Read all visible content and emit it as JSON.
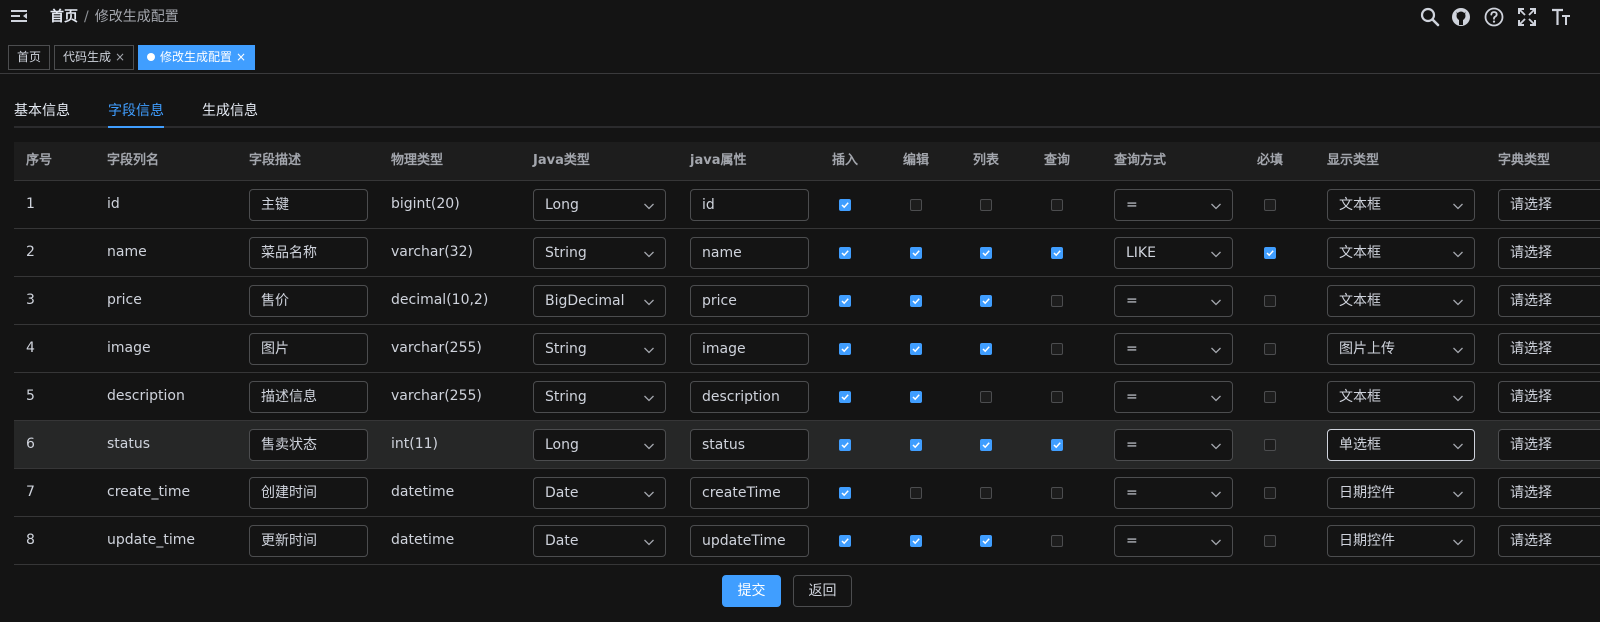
{
  "header": {
    "breadcrumb": {
      "home": "首页",
      "separator": "/",
      "current": "修改生成配置"
    },
    "icons": [
      "hamburger-icon",
      "search-icon",
      "github-icon",
      "help-icon",
      "fullscreen-icon",
      "font-size-icon"
    ]
  },
  "tags": [
    {
      "label": "首页",
      "closable": false,
      "active": false
    },
    {
      "label": "代码生成",
      "closable": true,
      "active": false
    },
    {
      "label": "修改生成配置",
      "closable": true,
      "active": true
    }
  ],
  "tag_close_glyph": "×",
  "tabs": [
    {
      "label": "基本信息",
      "active": false
    },
    {
      "label": "字段信息",
      "active": true
    },
    {
      "label": "生成信息",
      "active": false
    }
  ],
  "table": {
    "headers": [
      "序号",
      "字段列名",
      "字段描述",
      "物理类型",
      "Java类型",
      "java属性",
      "插入",
      "编辑",
      "列表",
      "查询",
      "查询方式",
      "必填",
      "显示类型",
      "字典类型"
    ],
    "rows": [
      {
        "no": "1",
        "column": "id",
        "desc": "主键",
        "physical": "bigint(20)",
        "java_type": "Long",
        "java_field": "id",
        "insert": true,
        "edit": false,
        "list": false,
        "query": false,
        "query_type": "=",
        "required": false,
        "html_type": "文本框",
        "dict": "请选择"
      },
      {
        "no": "2",
        "column": "name",
        "desc": "菜品名称",
        "physical": "varchar(32)",
        "java_type": "String",
        "java_field": "name",
        "insert": true,
        "edit": true,
        "list": true,
        "query": true,
        "query_type": "LIKE",
        "required": true,
        "html_type": "文本框",
        "dict": "请选择"
      },
      {
        "no": "3",
        "column": "price",
        "desc": "售价",
        "physical": "decimal(10,2)",
        "java_type": "BigDecimal",
        "java_field": "price",
        "insert": true,
        "edit": true,
        "list": true,
        "query": false,
        "query_type": "=",
        "required": false,
        "html_type": "文本框",
        "dict": "请选择"
      },
      {
        "no": "4",
        "column": "image",
        "desc": "图片",
        "physical": "varchar(255)",
        "java_type": "String",
        "java_field": "image",
        "insert": true,
        "edit": true,
        "list": true,
        "query": false,
        "query_type": "=",
        "required": false,
        "html_type": "图片上传",
        "dict": "请选择"
      },
      {
        "no": "5",
        "column": "description",
        "desc": "描述信息",
        "physical": "varchar(255)",
        "java_type": "String",
        "java_field": "description",
        "insert": true,
        "edit": true,
        "list": false,
        "query": false,
        "query_type": "=",
        "required": false,
        "html_type": "文本框",
        "dict": "请选择"
      },
      {
        "no": "6",
        "column": "status",
        "desc": "售卖状态",
        "physical": "int(11)",
        "java_type": "Long",
        "java_field": "status",
        "insert": true,
        "edit": true,
        "list": true,
        "query": true,
        "query_type": "=",
        "required": false,
        "html_type": "单选框",
        "dict": "请选择"
      },
      {
        "no": "7",
        "column": "create_time",
        "desc": "创建时间",
        "physical": "datetime",
        "java_type": "Date",
        "java_field": "createTime",
        "insert": true,
        "edit": false,
        "list": false,
        "query": false,
        "query_type": "=",
        "required": false,
        "html_type": "日期控件",
        "dict": "请选择"
      },
      {
        "no": "8",
        "column": "update_time",
        "desc": "更新时间",
        "physical": "datetime",
        "java_type": "Date",
        "java_field": "updateTime",
        "insert": true,
        "edit": true,
        "list": true,
        "query": false,
        "query_type": "=",
        "required": false,
        "html_type": "日期控件",
        "dict": "请选择"
      }
    ]
  },
  "footer": {
    "submit_label": "提交",
    "back_label": "返回"
  },
  "colors": {
    "accent": "#409eff",
    "background": "#141414",
    "header_row": "#1d1d1d",
    "border": "#4c4d4f"
  }
}
